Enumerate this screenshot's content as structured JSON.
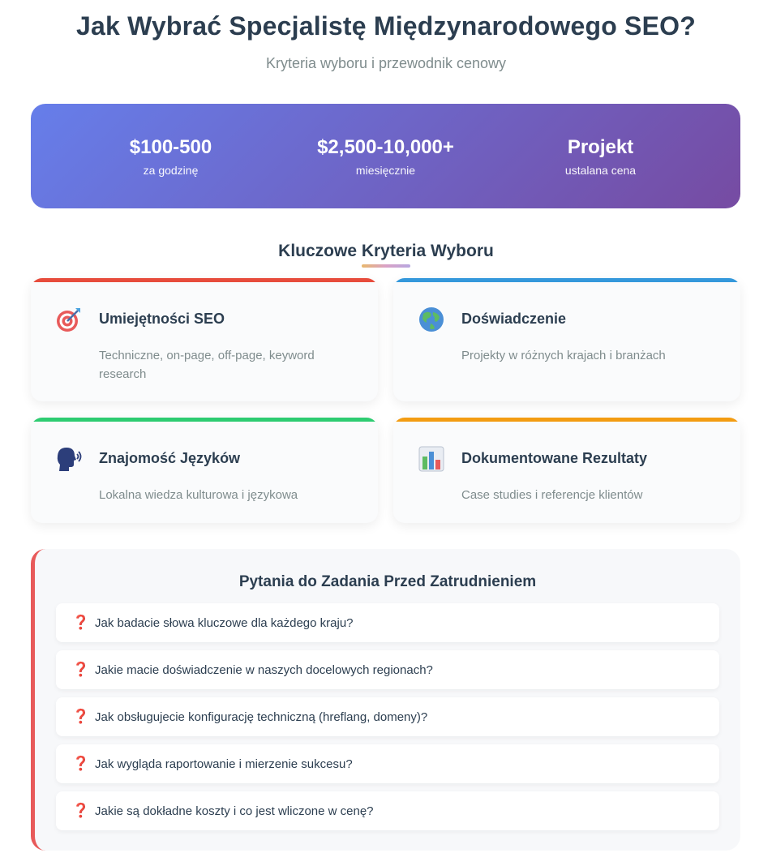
{
  "header": {
    "title": "Jak Wybrać Specjalistę Międzynarodowego SEO?",
    "subtitle": "Kryteria wyboru i przewodnik cenowy"
  },
  "pricing": [
    {
      "value": "$100-500",
      "label": "za godzinę"
    },
    {
      "value": "$2,500-10,000+",
      "label": "miesięcznie"
    },
    {
      "value": "Projekt",
      "label": "ustalana cena"
    }
  ],
  "criteria": {
    "title": "Kluczowe Kryteria Wyboru",
    "cards": [
      {
        "icon": "target-icon",
        "title": "Umiejętności SEO",
        "desc": "Techniczne, on-page, off-page, keyword research",
        "accent": "#e74c3c"
      },
      {
        "icon": "globe-icon",
        "title": "Doświadczenie",
        "desc": "Projekty w różnych krajach i branżach",
        "accent": "#3498db"
      },
      {
        "icon": "speaking-head-icon",
        "title": "Znajomość Języków",
        "desc": "Lokalna wiedza kulturowa i językowa",
        "accent": "#2ecc71"
      },
      {
        "icon": "bar-chart-icon",
        "title": "Dokumentowane Rezultaty",
        "desc": "Case studies i referencje klientów",
        "accent": "#f39c12"
      }
    ]
  },
  "questions": {
    "title": "Pytania do Zadania Przed Zatrudnieniem",
    "mark": "❓",
    "items": [
      "Jak badacie słowa kluczowe dla każdego kraju?",
      "Jakie macie doświadczenie w naszych docelowych regionach?",
      "Jak obsługujecie konfigurację techniczną (hreflang, domeny)?",
      "Jak wygląda raportowanie i mierzenie sukcesu?",
      "Jakie są dokładne koszty i co jest wliczone w cenę?"
    ]
  }
}
